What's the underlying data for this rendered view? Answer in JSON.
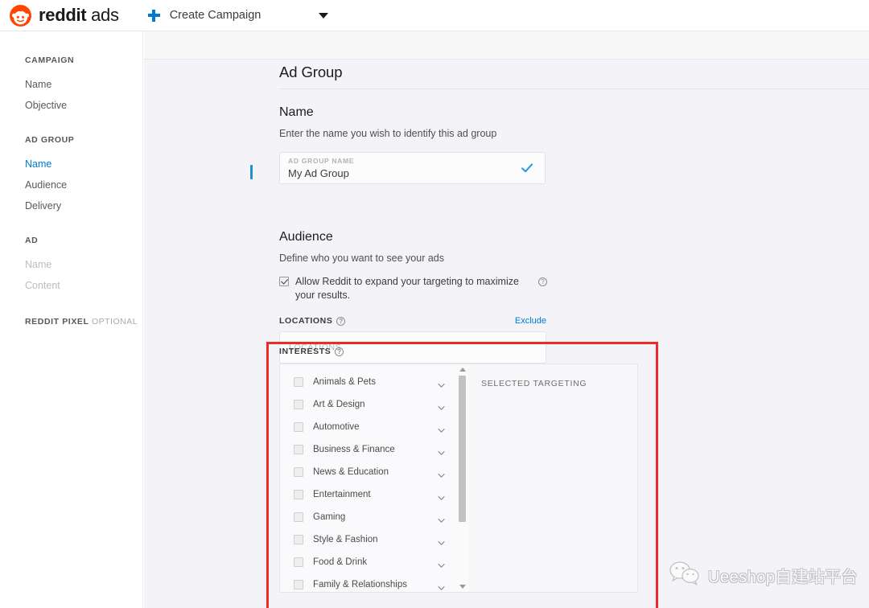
{
  "topbar": {
    "brand_bold": "reddit",
    "brand_light": " ads",
    "create_campaign_label": "Create Campaign",
    "plus_icon": "plus-icon",
    "caret_icon": "chevron-down-icon",
    "logo_icon": "reddit-alien-logo",
    "accent_color": "#ff4500",
    "link_color": "#0079d3"
  },
  "sidebar": {
    "groups": [
      {
        "heading": "CAMPAIGN",
        "items": [
          {
            "label": "Name",
            "state": "default"
          },
          {
            "label": "Objective",
            "state": "default"
          }
        ]
      },
      {
        "heading": "AD GROUP",
        "items": [
          {
            "label": "Name",
            "state": "active"
          },
          {
            "label": "Audience",
            "state": "default"
          },
          {
            "label": "Delivery",
            "state": "default"
          }
        ]
      },
      {
        "heading": "AD",
        "items": [
          {
            "label": "Name",
            "state": "disabled"
          },
          {
            "label": "Content",
            "state": "disabled"
          }
        ]
      },
      {
        "heading": "REDDIT PIXEL",
        "heading_optional": " OPTIONAL",
        "items": []
      }
    ]
  },
  "main": {
    "page_title": "Ad Group",
    "name_section": {
      "title": "Name",
      "subtitle": "Enter the name you wish to identify this ad group",
      "field_label": "AD GROUP NAME",
      "field_value": "My Ad Group",
      "valid_icon": "check-icon",
      "valid_color": "#2a9fe0"
    },
    "audience_section": {
      "title": "Audience",
      "subtitle": "Define who you want to see your ads",
      "expand_checkbox_checked": true,
      "expand_label": "Allow Reddit to expand your targeting to maximize your results.",
      "expand_help_icon": "help-icon",
      "locations_label": "LOCATIONS",
      "locations_help_icon": "help-icon",
      "exclude_label": "Exclude",
      "locations_placeholder": "LOCATIONS"
    },
    "interests_section": {
      "label": "INTERESTS",
      "help_icon": "help-icon",
      "items": [
        {
          "label": "Animals & Pets",
          "checked": false
        },
        {
          "label": "Art & Design",
          "checked": false
        },
        {
          "label": "Automotive",
          "checked": false
        },
        {
          "label": "Business & Finance",
          "checked": false
        },
        {
          "label": "News & Education",
          "checked": false
        },
        {
          "label": "Entertainment",
          "checked": false
        },
        {
          "label": "Gaming",
          "checked": false
        },
        {
          "label": "Style & Fashion",
          "checked": false
        },
        {
          "label": "Food & Drink",
          "checked": false
        },
        {
          "label": "Family & Relationships",
          "checked": false
        }
      ],
      "expand_icon": "chevron-down-icon",
      "scrollbar": {
        "up_icon": "triangle-up-icon",
        "down_icon": "triangle-down-icon"
      },
      "selected_panel_label": "SELECTED TARGETING"
    }
  },
  "annotation": {
    "color": "#ee2b2b"
  },
  "watermark": {
    "icon": "wechat-icon",
    "text": "Ueeshop自建站平台"
  }
}
